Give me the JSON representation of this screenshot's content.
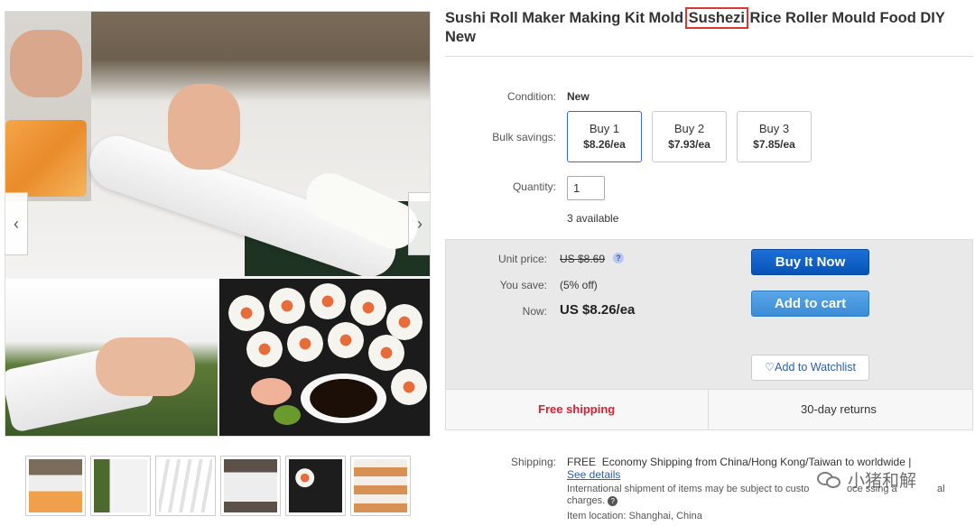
{
  "product": {
    "title_before": "Sushi Roll Maker Making Kit Mold ",
    "title_highlight": "Sushezi",
    "title_after": " Rice Roller Mould Food DIY New"
  },
  "gallery": {
    "prev_glyph": "‹",
    "next_glyph": "›",
    "thumbnail_count": 6
  },
  "details": {
    "condition_label": "Condition:",
    "condition_value": "New",
    "bulk_label": "Bulk savings:",
    "bulk_options": [
      {
        "qty": "Buy 1",
        "price": "$8.26/ea",
        "selected": true
      },
      {
        "qty": "Buy 2",
        "price": "$7.93/ea",
        "selected": false
      },
      {
        "qty": "Buy 3",
        "price": "$7.85/ea",
        "selected": false
      }
    ],
    "quantity_label": "Quantity:",
    "quantity_value": "1",
    "available_text": "3 available"
  },
  "pricing": {
    "unit_price_label": "Unit price:",
    "unit_price_value": "US $8.69",
    "you_save_label": "You save:",
    "you_save_value": "(5% off)",
    "now_label": "Now:",
    "now_value": "US $8.26/ea",
    "info_icon_glyph": "?"
  },
  "actions": {
    "buy_now": "Buy It Now",
    "add_to_cart": "Add to cart",
    "watchlist": "Add to Watchlist",
    "watchlist_icon_glyph": "♡"
  },
  "footer_bar": {
    "free_shipping": "Free shipping",
    "returns": "30-day returns"
  },
  "shipping": {
    "label": "Shipping:",
    "free": "FREE",
    "desc": "Economy Shipping from China/Hong Kong/Taiwan to worldwide |",
    "see_details": "See details",
    "intl_note_1": "International shipment of items may be subject to custo",
    "intl_note_2": "oce ssing a",
    "intl_note_3": "al",
    "intl_note_charges": "charges.",
    "location": "Item location:  Shanghai, China"
  },
  "watermark": {
    "text": "小猪和解"
  },
  "colors": {
    "highlight_box": "#e0342f",
    "buy_button": "#0653b6",
    "cart_button": "#3a8ad6",
    "free_shipping": "#dd1e31",
    "link": "#2a5db0"
  }
}
